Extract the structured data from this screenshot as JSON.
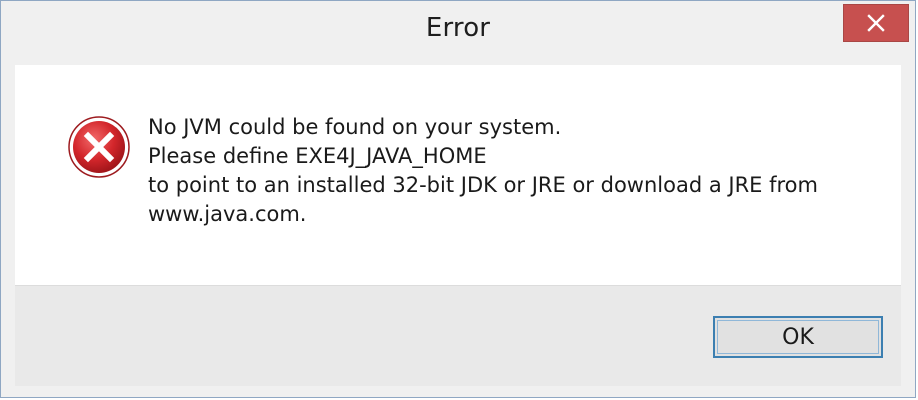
{
  "window": {
    "title": "Error",
    "close_icon": "close-icon"
  },
  "message": {
    "icon": "error-icon",
    "lines": [
      "No JVM could be found on your system.",
      "Please define EXE4J_JAVA_HOME",
      "to point to an installed 32-bit JDK or JRE or download a JRE from",
      "www.java.com."
    ]
  },
  "buttons": {
    "ok_label": "OK"
  },
  "colors": {
    "close_button": "#c7504f",
    "error_icon": "#c8262a",
    "focus_border": "#3c7fb1"
  }
}
